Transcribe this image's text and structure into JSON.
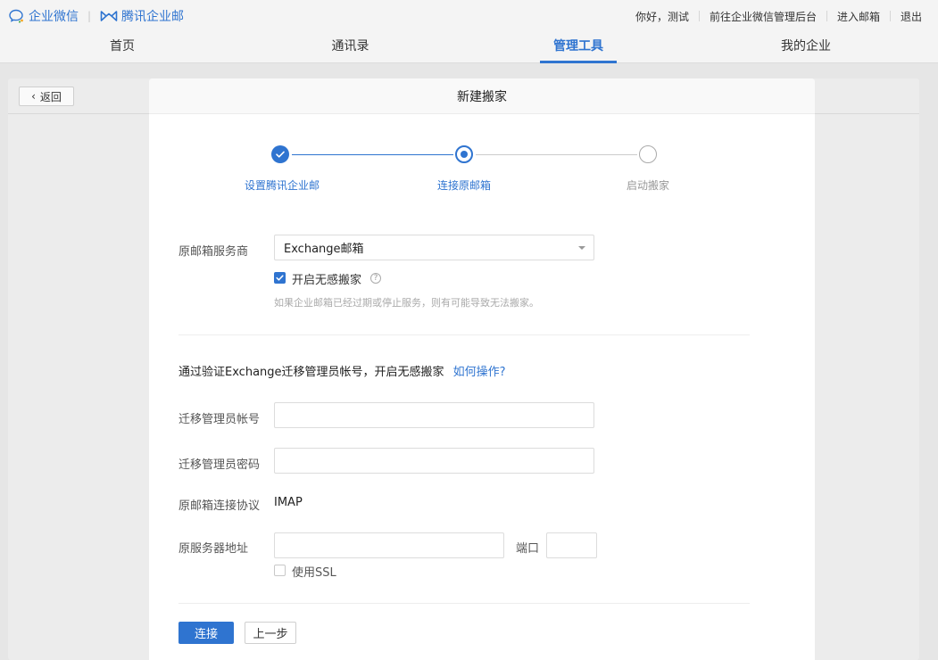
{
  "topbar": {
    "logo_wework": "企业微信",
    "logo_mail": "腾讯企业邮",
    "greeting": "你好，测试",
    "admin_link": "前往企业微信管理后台",
    "mail_link": "进入邮箱",
    "logout": "退出"
  },
  "nav": {
    "tabs": [
      {
        "label": "首页"
      },
      {
        "label": "通讯录"
      },
      {
        "label": "管理工具"
      },
      {
        "label": "我的企业"
      }
    ],
    "active": "管理工具"
  },
  "back_button": "返回",
  "modal": {
    "title": "新建搬家",
    "steps": [
      {
        "label": "设置腾讯企业邮",
        "status": "done"
      },
      {
        "label": "连接原邮箱",
        "status": "current"
      },
      {
        "label": "启动搬家",
        "status": "todo"
      }
    ],
    "provider": {
      "label": "原邮箱服务商",
      "value": "Exchange邮箱"
    },
    "seamless": {
      "label": "开启无感搬家",
      "checked": true,
      "help": "?",
      "hint": "如果企业邮箱已经过期或停止服务，则有可能导致无法搬家。"
    },
    "verify_text": "通过验证Exchange迁移管理员帐号，开启无感搬家",
    "how_link": "如何操作?",
    "admin_account": {
      "label": "迁移管理员帐号",
      "value": ""
    },
    "admin_password": {
      "label": "迁移管理员密码",
      "value": ""
    },
    "protocol": {
      "label": "原邮箱连接协议",
      "value": "IMAP"
    },
    "server": {
      "label": "原服务器地址",
      "value": "",
      "port_label": "端口",
      "port_value": ""
    },
    "ssl": {
      "label": "使用SSL",
      "checked": false
    },
    "connect_button": "连接",
    "prev_button": "上一步"
  },
  "colors": {
    "accent": "#2f74d0"
  }
}
